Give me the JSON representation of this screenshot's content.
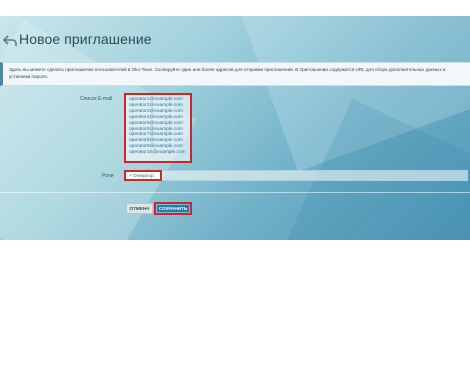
{
  "title": "Новое приглашение",
  "info": "Здесь вы можете сделать приглашение пользователей в Oko-Town. Скопируйте один или более адресов для отправки приглашений. В приглашении содержится URL для сбора дополнительных данных и установки пароля.",
  "form": {
    "emails_label": "Список E-mail",
    "emails": [
      "operator1@example.com",
      "operator2@example.com",
      "operator3@example.com",
      "operator4@example.com",
      "operator5@example.com",
      "operator6@example.com",
      "operator7@example.com",
      "operator8@example.com",
      "operator9@example.com",
      "operator10@example.com"
    ],
    "role_label": "Роли",
    "role_value": "× Оператор"
  },
  "buttons": {
    "cancel": "ОТМЕНА",
    "save": "СОХРАНИТЬ"
  },
  "colors": {
    "accent": "#2c77ad",
    "highlight": "#c9272a"
  }
}
